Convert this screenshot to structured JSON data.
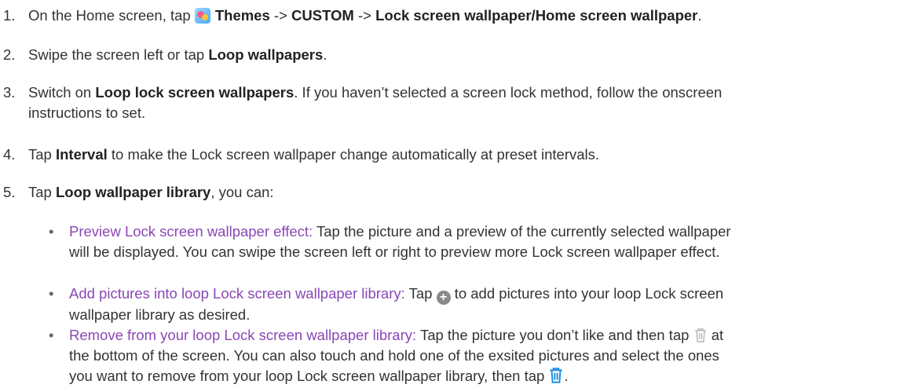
{
  "steps": [
    {
      "num": "1.",
      "pre": "On the Home screen, tap ",
      "themes": "Themes",
      "s1": " -> ",
      "custom": "CUSTOM",
      "s2": " -> ",
      "lock": "Lock screen wallpaper",
      "slash": "/",
      "home": "Home screen wallpaper",
      "end": "."
    },
    {
      "num": "2.",
      "pre": "Swipe the screen left or tap ",
      "bold": "Loop wallpapers",
      "end": "."
    },
    {
      "num": "3.",
      "pre": "Switch on ",
      "bold": "Loop lock screen wallpapers",
      "l1": ". If you haven’t selected a screen lock method, follow the onscreen",
      "l2": "instructions to set."
    },
    {
      "num": "4.",
      "pre": "Tap ",
      "bold": "Interval",
      "end": " to make the Lock screen wallpaper change automatically at preset intervals."
    },
    {
      "num": "5.",
      "pre": "Tap ",
      "bold": "Loop wallpaper library",
      "end": ", you can:"
    }
  ],
  "bullets": [
    {
      "marker": "•",
      "title": "Preview Lock screen wallpaper effect:",
      "l1": " Tap the picture and a preview of the currently selected wallpaper",
      "l2": "will be displayed. You can swipe the screen left or right to preview more Lock screen wallpaper effect."
    },
    {
      "marker": "•",
      "title": "Add pictures into loop Lock screen wallpaper library:",
      "pre": " Tap ",
      "post": " to add pictures into your loop Lock screen",
      "l2": "wallpaper library as desired."
    },
    {
      "marker": "•",
      "title": "Remove from your loop Lock screen wallpaper library:",
      "pre": " Tap the picture you don’t like and then tap ",
      "post": " at",
      "l2": "the bottom of the screen. You can also touch and hold one of the exsited pictures and select the ones",
      "l3pre": "you want to remove from your loop Lock screen wallpaper library, then tap ",
      "l3post": "."
    }
  ],
  "colors": {
    "accent": "#8a47b5",
    "trash_gray": "#b5b5b5",
    "trash_blue": "#1f8fe5",
    "plus_bg": "#8a8a8a"
  },
  "icons": {
    "themes": "themes-app-icon",
    "plus": "plus-circle-icon",
    "trash": "trash-icon"
  }
}
